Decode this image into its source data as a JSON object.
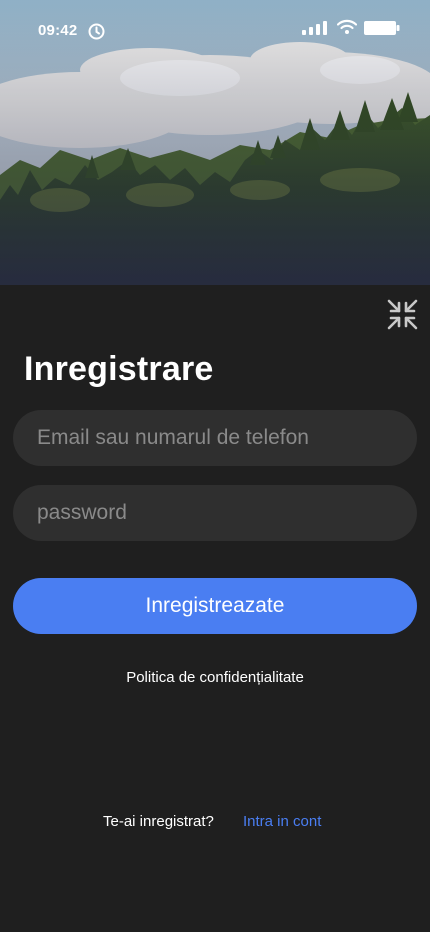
{
  "status_bar": {
    "time": "09:42"
  },
  "register": {
    "title": "Inregistrare",
    "email_placeholder": "Email sau numarul de telefon",
    "password_placeholder": "password",
    "submit_label": "Inregistreazate",
    "privacy_label": "Politica de confidențialitate",
    "signin_question": "Te-ai inregistrat?",
    "signin_link": "Intra in cont"
  },
  "colors": {
    "background": "#1f1f1f",
    "field_background": "#2f2f2f",
    "accent": "#4a7ef2"
  },
  "icons": {
    "clock": "clock-icon",
    "signal": "signal-icon",
    "wifi": "wifi-icon",
    "battery": "battery-icon",
    "collapse": "collapse-icon"
  }
}
